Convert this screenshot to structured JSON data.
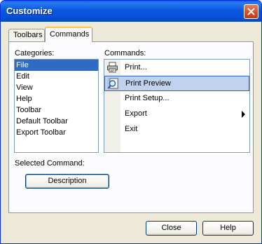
{
  "window": {
    "title": "Customize"
  },
  "tabs": [
    {
      "label": "Toolbars",
      "active": false
    },
    {
      "label": "Commands",
      "active": true
    }
  ],
  "categories": {
    "label": "Categories:",
    "items": [
      "File",
      "Edit",
      "View",
      "Help",
      "Toolbar",
      "Default Toolbar",
      "Export Toolbar"
    ],
    "selected": "File"
  },
  "commands": {
    "label": "Commands:",
    "items": [
      {
        "label": "Print...",
        "icon": "printer-icon"
      },
      {
        "label": "Print Preview",
        "icon": "print-preview-icon",
        "selected": true
      },
      {
        "label": "Print Setup..."
      },
      {
        "label": "Export",
        "submenu": true
      },
      {
        "label": "Exit"
      }
    ]
  },
  "selected_command": {
    "label": "Selected Command:",
    "description_button": "Description"
  },
  "buttons": {
    "close": "Close",
    "help": "Help"
  },
  "colors": {
    "titlebar": "#0a58e0",
    "selection": "#316ac5",
    "hover_selection": "#c1d2ee",
    "tab_accent": "#ffc83c"
  }
}
